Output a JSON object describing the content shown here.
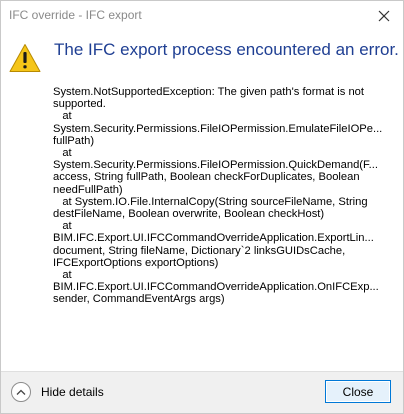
{
  "window": {
    "title": "IFC override - IFC export"
  },
  "message": {
    "headline": "The IFC export process encountered an error.",
    "icon": "warning-icon"
  },
  "details": {
    "lines": [
      "System.NotSupportedException: The given path's format is not",
      "supported.",
      "   at",
      "System.Security.Permissions.FileIOPermission.EmulateFileIOPe...",
      "fullPath)",
      "   at",
      "System.Security.Permissions.FileIOPermission.QuickDemand(F...",
      "access, String fullPath, Boolean checkForDuplicates, Boolean",
      "needFullPath)",
      "   at System.IO.File.InternalCopy(String sourceFileName, String",
      "destFileName, Boolean overwrite, Boolean checkHost)",
      "   at",
      "BIM.IFC.Export.UI.IFCCommandOverrideApplication.ExportLin...",
      "document, String fileName, Dictionary`2 linksGUIDsCache,",
      "IFCExportOptions exportOptions)",
      "   at",
      "BIM.IFC.Export.UI.IFCCommandOverrideApplication.OnIFCExp...",
      "sender, CommandEventArgs args)"
    ]
  },
  "footer": {
    "toggle_label": "Hide details",
    "close_label": "Close"
  },
  "colors": {
    "headline": "#1f3f93",
    "accent": "#0078d7",
    "warning_fill": "#f5c518"
  }
}
